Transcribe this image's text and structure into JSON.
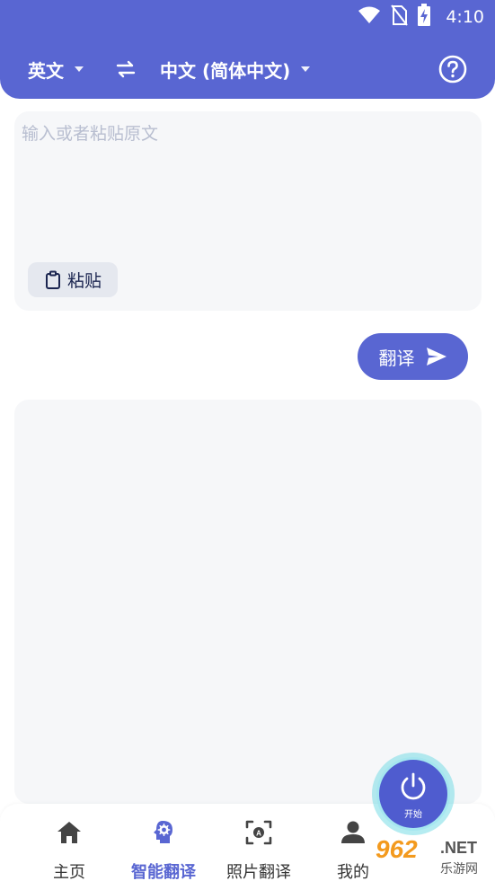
{
  "status_bar": {
    "time": "4:10"
  },
  "header": {
    "source_language": "英文",
    "target_language": "中文 (简体中文)"
  },
  "input": {
    "placeholder": "输入或者粘贴原文",
    "value": "",
    "paste_label": "粘贴"
  },
  "translate_button": {
    "label": "翻译"
  },
  "bottom_nav": {
    "items": [
      {
        "label": "主页",
        "icon": "home-icon"
      },
      {
        "label": "智能翻译",
        "icon": "smart-translate-icon"
      },
      {
        "label": "照片翻译",
        "icon": "photo-translate-icon"
      },
      {
        "label": "我的",
        "icon": "profile-icon"
      }
    ],
    "active_index": 1
  },
  "start_button": {
    "label": "开始"
  },
  "watermark": {
    "number": "962",
    "suffix": ".NET",
    "site": "乐游网"
  },
  "colors": {
    "primary": "#5966d2",
    "card_background": "#f6f7f9",
    "placeholder": "#b8bed0",
    "watermark_orange": "#f39a1e"
  }
}
